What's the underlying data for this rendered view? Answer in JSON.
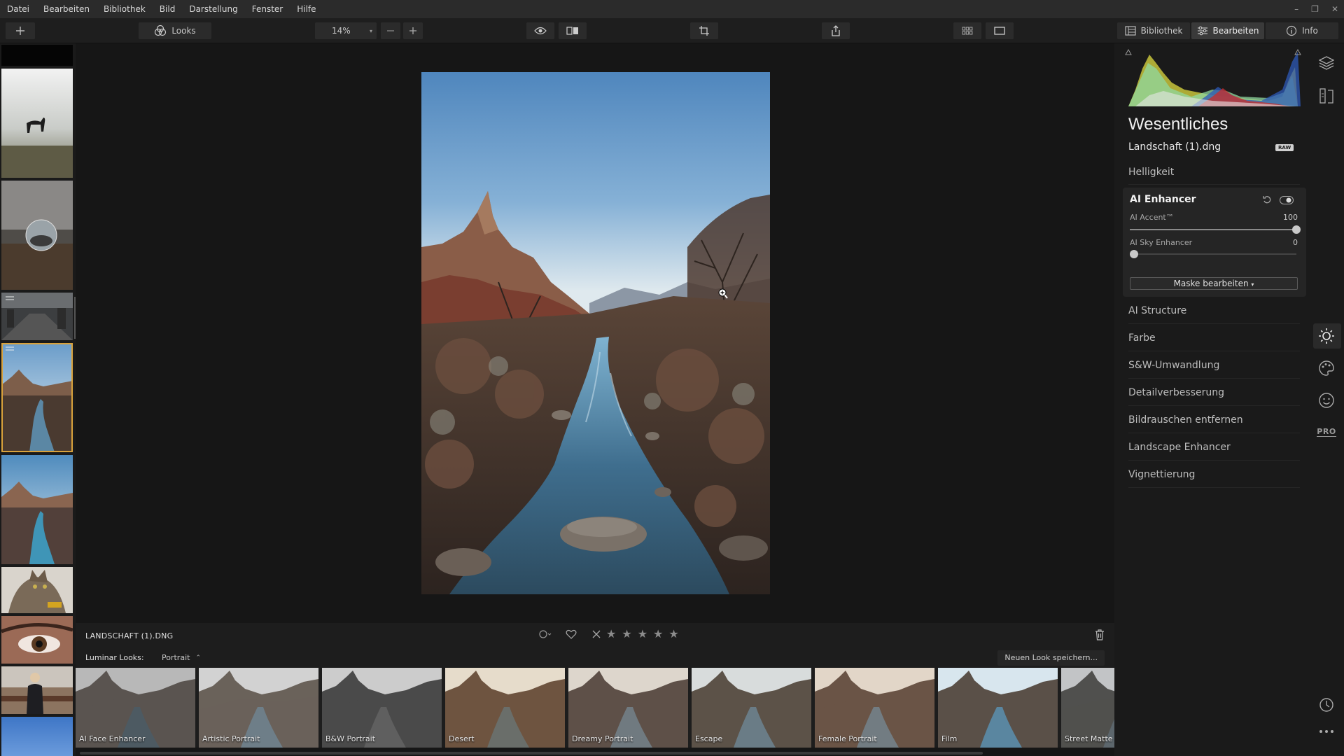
{
  "menu": [
    "Datei",
    "Bearbeiten",
    "Bibliothek",
    "Bild",
    "Darstellung",
    "Fenster",
    "Hilfe"
  ],
  "toolbar": {
    "looks_label": "Looks",
    "zoom_value": "14%",
    "library_label": "Bibliothek",
    "edit_label": "Bearbeiten",
    "info_label": "Info"
  },
  "image": {
    "file_name_caps": "LANDSCHAFT (1).DNG",
    "file_name": "Landschaft (1).dng",
    "raw_badge": "RAW"
  },
  "looks": {
    "label": "Luminar Looks:",
    "category": "Portrait",
    "save_button": "Neuen Look speichern...",
    "items": [
      "AI Face Enhancer",
      "Artistic Portrait",
      "B&W Portrait",
      "Desert",
      "Dreamy Portrait",
      "Escape",
      "Female Portrait",
      "Film",
      "Street Matte"
    ]
  },
  "panel": {
    "title": "Wesentliches",
    "helligkeit": "Helligkeit",
    "enhancer": {
      "title": "AI Enhancer",
      "accent_label": "AI Accent™",
      "accent_value": "100",
      "sky_label": "AI Sky Enhancer",
      "sky_value": "0",
      "mask_button": "Maske bearbeiten"
    },
    "sections": [
      "AI Structure",
      "Farbe",
      "S&W-Umwandlung",
      "Detailverbesserung",
      "Bildrauschen entfernen",
      "Landscape Enhancer",
      "Vignettierung"
    ]
  },
  "rail": {
    "pro_label": "PRO"
  },
  "icons": [
    "add-icon",
    "looks-icon",
    "minus-icon",
    "plus-icon",
    "eye-icon",
    "compare-icon",
    "crop-icon",
    "share-icon",
    "grid-icon",
    "single-view-icon",
    "library-icon",
    "sliders-icon",
    "info-icon",
    "layers-icon",
    "canvas-icon",
    "sun-icon",
    "palette-icon",
    "face-icon",
    "history-icon",
    "more-icon",
    "trash-icon",
    "heart-icon",
    "reject-icon",
    "star-icon"
  ],
  "colors": {
    "accent_selected": "#d9a23b",
    "background": "#161616",
    "panel": "#1a1a1a"
  }
}
